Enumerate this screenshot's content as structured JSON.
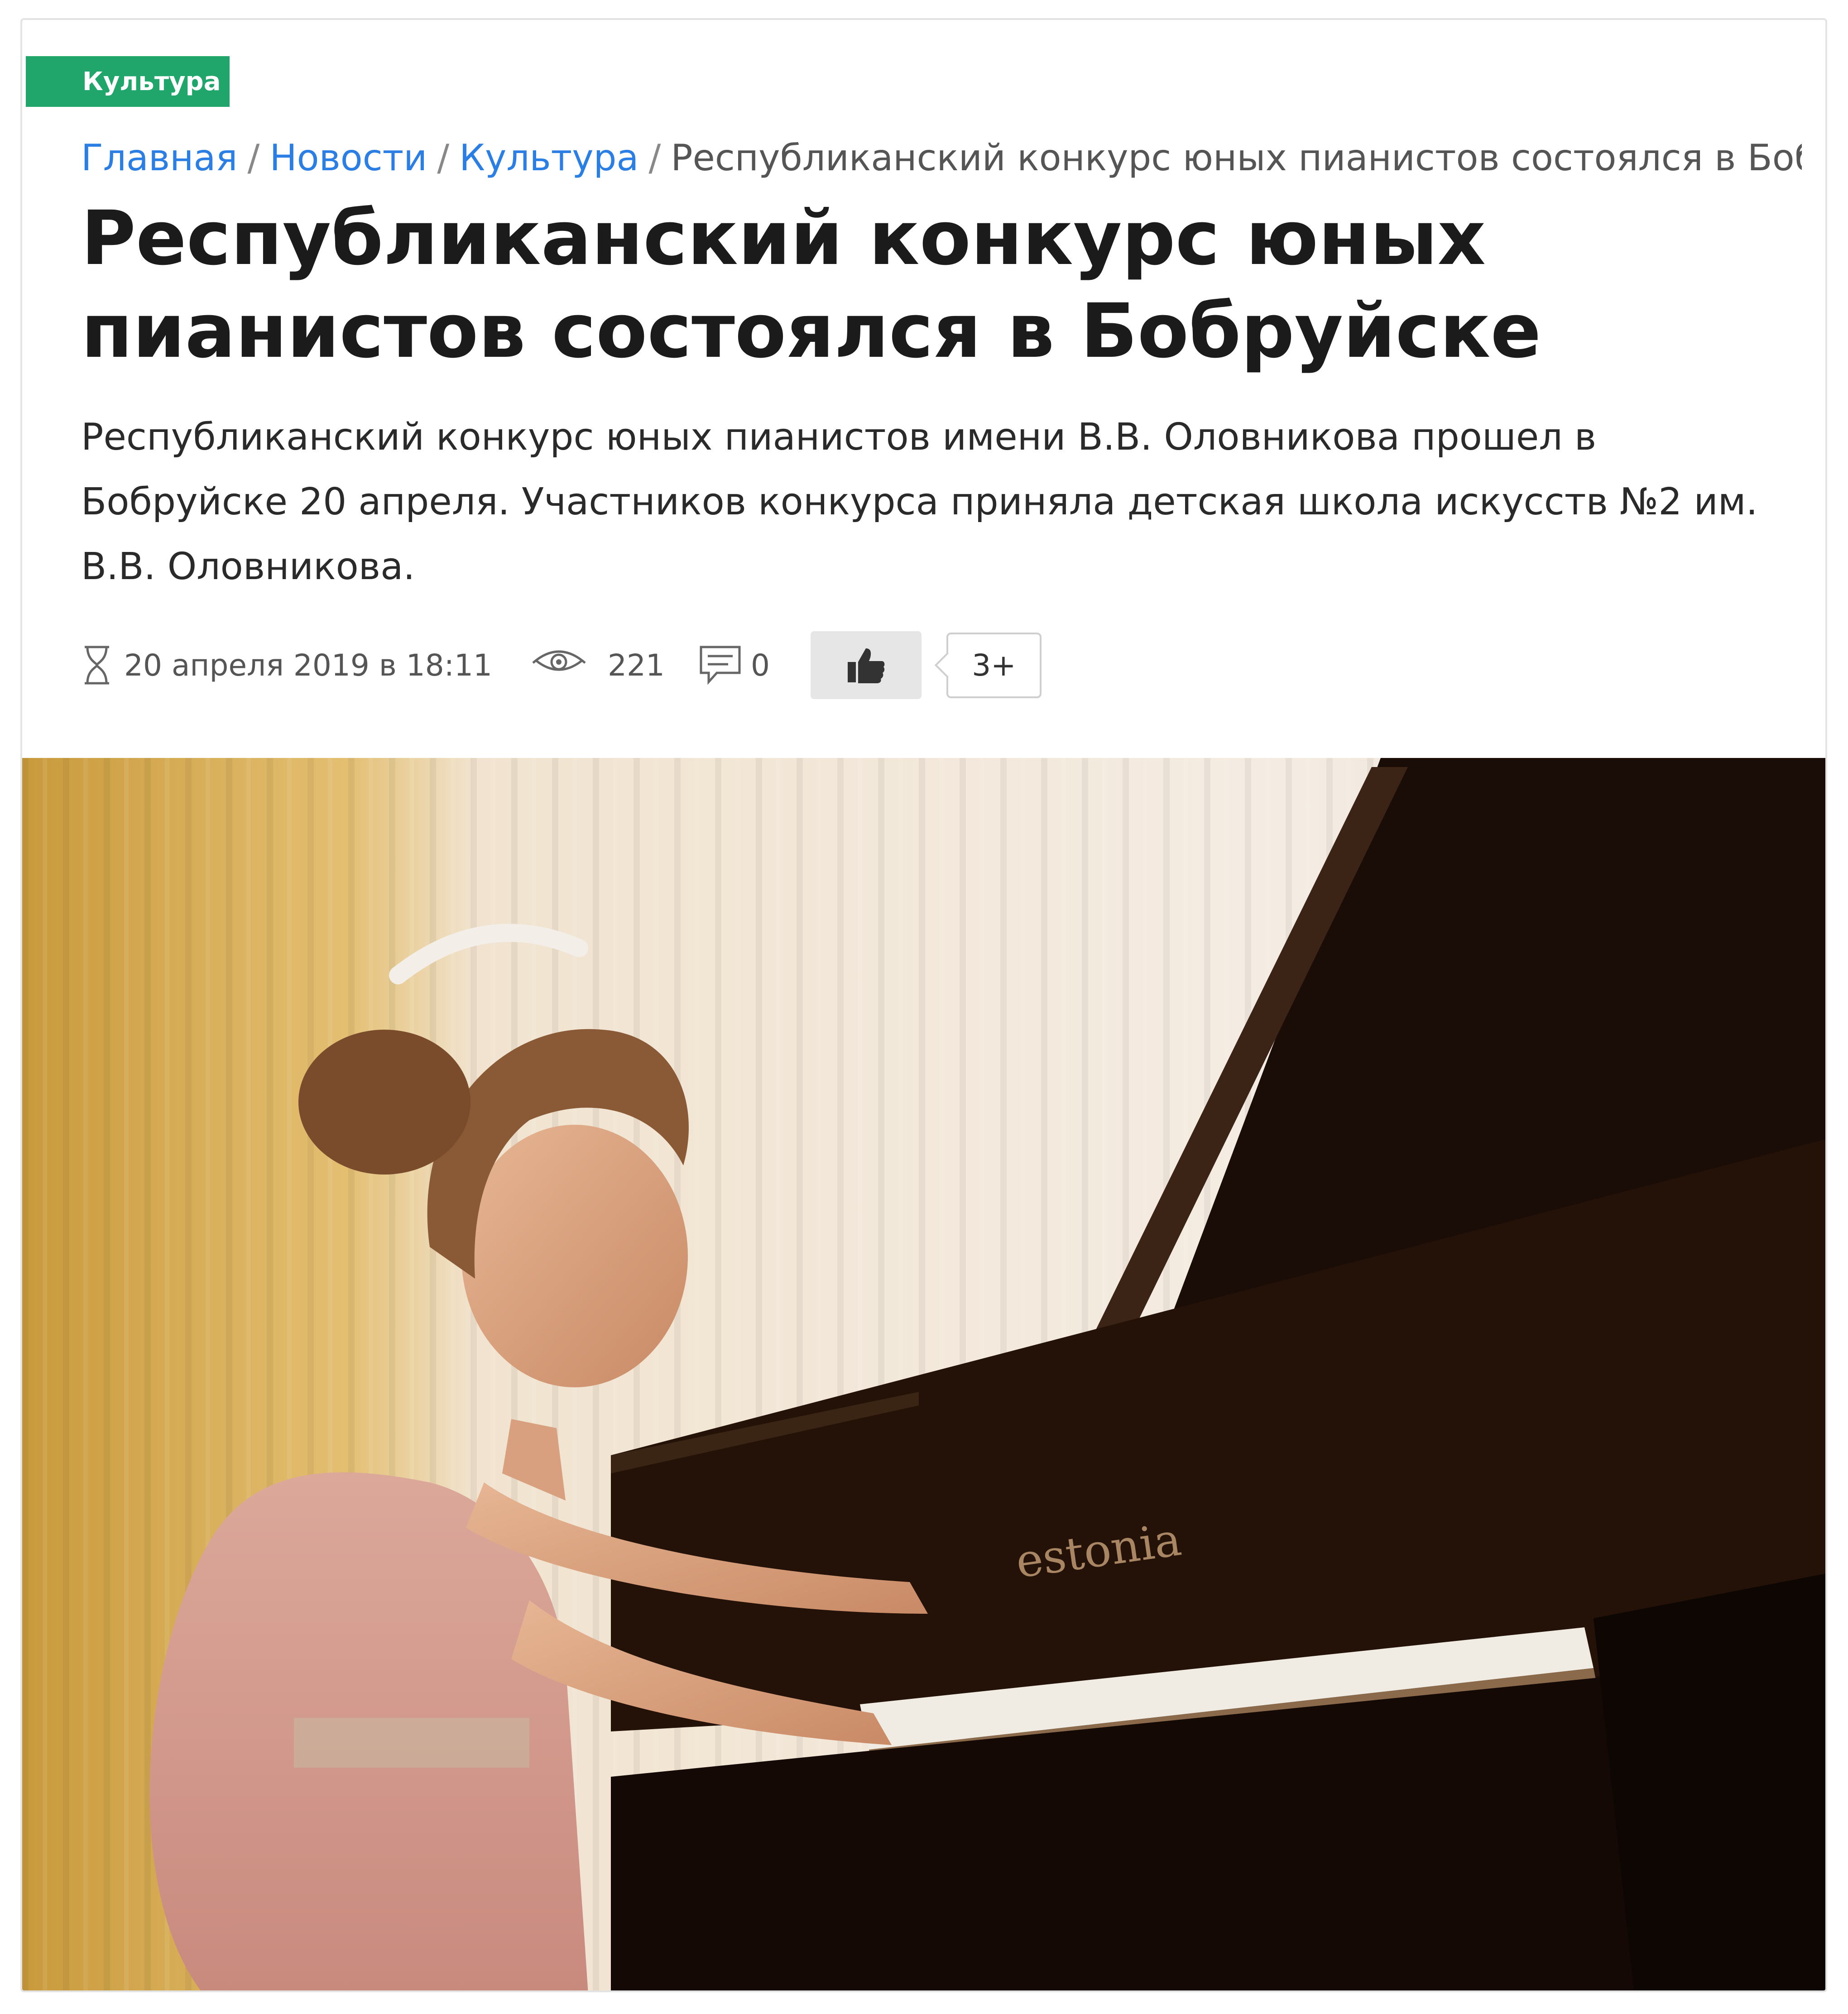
{
  "article": {
    "category": "Культура",
    "breadcrumb": {
      "home": "Главная",
      "news": "Новости",
      "category": "Культура",
      "current": "Республиканский конкурс юных пианистов состоялся в Боб…",
      "separator": "/"
    },
    "title": "Республиканский конкурс юных пианистов состоялся в Бобруйске",
    "lead": "Республиканский конкурс юных пианистов имени В.В. Оловникова прошел в Бобруйске 20 апреля. Участников конкурса приняла детская школа искусств №2 им. В.В. Оловникова.",
    "meta": {
      "date": "20 апреля 2019 в 18:11",
      "views": "221",
      "comments": "0",
      "likes": "3+"
    },
    "photo": {
      "piano_brand": "estonia"
    }
  },
  "colors": {
    "category_bg": "#20a56b",
    "link": "#2b7ee4",
    "title": "#1b1b1b"
  }
}
